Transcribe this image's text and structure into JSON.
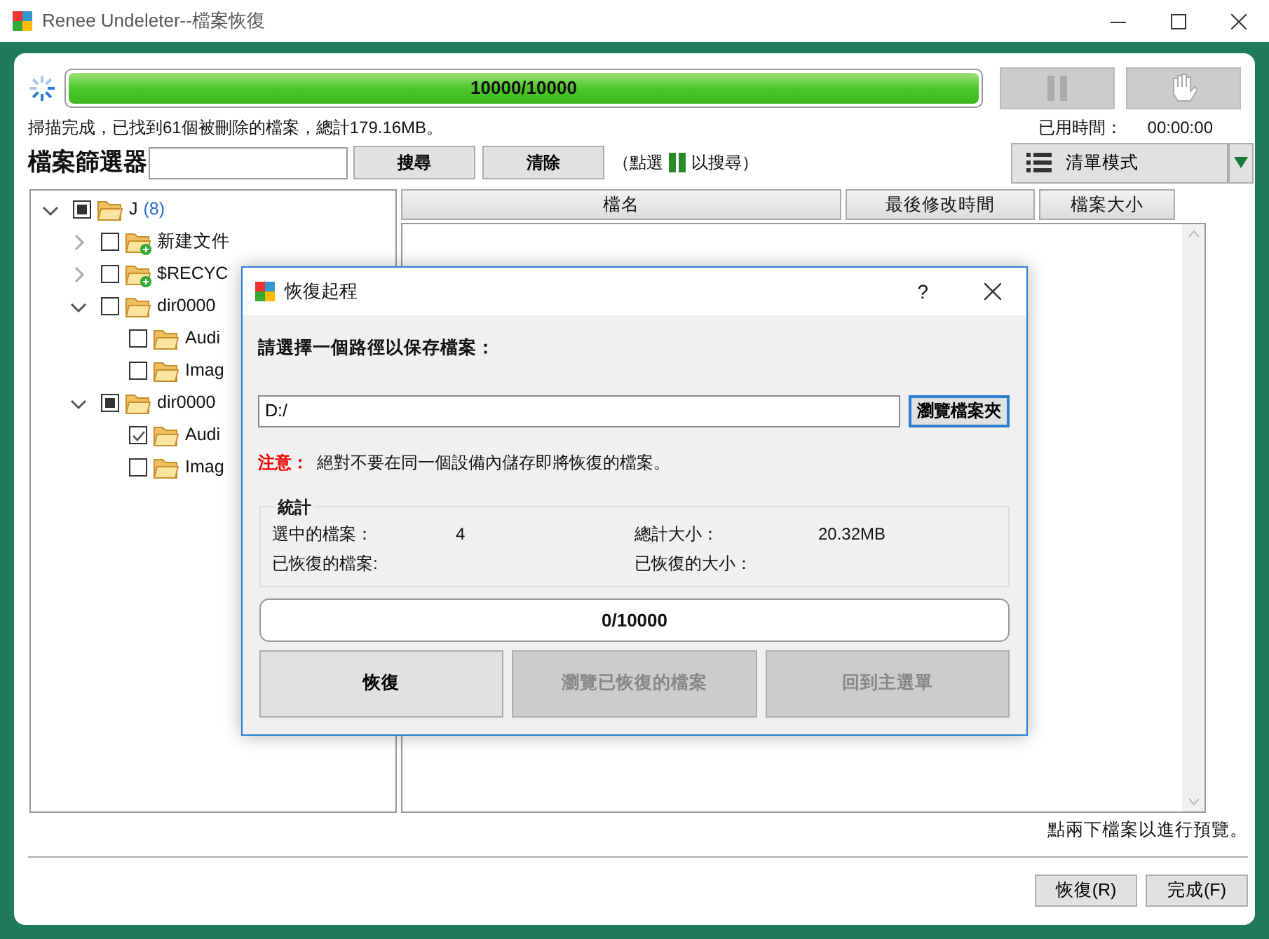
{
  "window": {
    "title": "Renee Undeleter--檔案恢復"
  },
  "scan": {
    "level": 1,
    "reading": "10000/10000",
    "status": "掃描完成，已找到61個被刪除的檔案，總計179.16MB。",
    "elapsed_label": "已用時間：",
    "elapsed": "00:00:00"
  },
  "filter": {
    "label": "檔案篩選器",
    "search_button": "搜尋",
    "clear_button": "清除",
    "hint_prefix": "（點選",
    "hint_suffix": "以搜尋）"
  },
  "view_mode": {
    "label": "清單模式"
  },
  "tree": [
    {
      "label": "J",
      "count": "(8)",
      "kind": "folder",
      "checked": false,
      "partial": true,
      "expanded": true,
      "children": [
        {
          "label": "新建文件",
          "kind": "folder-new",
          "checked": false,
          "partial": false,
          "expanded": false
        },
        {
          "label": "$RECYC",
          "kind": "folder-new",
          "checked": false,
          "partial": false,
          "expanded": false
        },
        {
          "label": "dir0000",
          "kind": "folder",
          "checked": false,
          "partial": false,
          "expanded": true,
          "children": [
            {
              "label": "Audi",
              "kind": "folder",
              "checked": false,
              "partial": false
            },
            {
              "label": "Imag",
              "kind": "folder",
              "checked": false,
              "partial": false
            }
          ]
        },
        {
          "label": "dir0000",
          "kind": "folder",
          "checked": false,
          "partial": true,
          "expanded": true,
          "children": [
            {
              "label": "Audi",
              "kind": "folder",
              "checked": true,
              "partial": false
            },
            {
              "label": "Imag",
              "kind": "folder",
              "checked": false,
              "partial": false
            }
          ]
        }
      ]
    }
  ],
  "columns": [
    "檔名",
    "最後修改時間",
    "檔案大小"
  ],
  "preview_hint": "點兩下檔案以進行預覽。",
  "footer_buttons": [
    "恢復(R)",
    "完成(F)"
  ],
  "dialog": {
    "title": "恢復起程",
    "help": "?",
    "prompt": "請選擇一個路徑以保存檔案：",
    "path": "D:/",
    "browse_button": "瀏覽檔案夾",
    "warning_label": "注意：",
    "warning": "絕對不要在同一個設備內儲存即將恢復的檔案。",
    "stats_title": "統計",
    "stats": [
      {
        "label": "選中的檔案：",
        "value": "4"
      },
      {
        "label": "總計大小：",
        "value": "20.32MB"
      },
      {
        "label": "已恢復的檔案:"
      },
      {
        "label": "已恢復的大小："
      }
    ],
    "progress": {
      "level": 0,
      "reading": "0/10000"
    },
    "buttons": [
      {
        "label": "恢復",
        "disabled": false
      },
      {
        "label": "瀏覽已恢復的檔案",
        "disabled": true
      },
      {
        "label": "回到主選單",
        "disabled": true
      }
    ]
  }
}
